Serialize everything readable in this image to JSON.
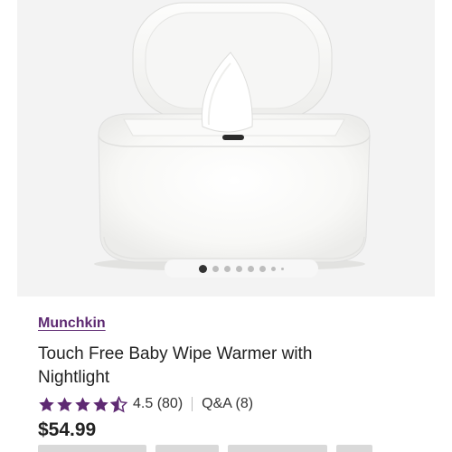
{
  "product": {
    "brand": "Munchkin",
    "title": "Touch Free Baby Wipe Warmer with Nightlight",
    "rating": 4.5,
    "rating_text": "4.5 (80)",
    "qa_text": "Q&A (8)",
    "price": "$54.99"
  },
  "gallery": {
    "image_count": 8,
    "active_index": 0,
    "image_icon": "baby-wipe-warmer"
  },
  "colors": {
    "brand": "#5e2a72",
    "star": "#5e2a72",
    "gallery_bg": "#f3f3f3",
    "text": "#222222"
  }
}
